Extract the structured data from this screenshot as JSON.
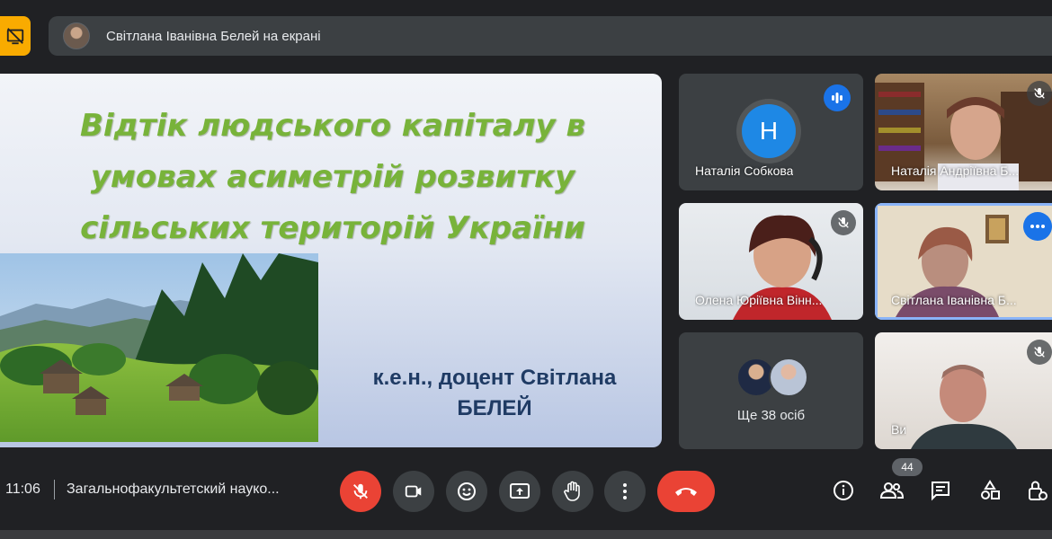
{
  "presenting_banner": {
    "text": "Світлана Іванівна Белей на екрані"
  },
  "slide": {
    "title": "Відтік  людського  капіталу в\nумовах асиметрій розвитку\nсільських територій України",
    "author_line1": "к.е.н., доцент Світлана",
    "author_line2": "БЕЛЕЙ",
    "title_color": "#78b33a",
    "author_color": "#1f3b64"
  },
  "participants": [
    {
      "name": "Наталія Собкова",
      "initial": "Н",
      "state": "speaking"
    },
    {
      "name": "Наталія Андріївна Б...",
      "state": "muted"
    },
    {
      "name": "Олена Юріївна Вінн...",
      "state": "muted"
    },
    {
      "name": "Світлана Іванівна Б...",
      "state": "presenting"
    },
    {
      "name": "Ви",
      "state": "muted"
    }
  ],
  "others": {
    "label": "Ще 38 осіб"
  },
  "bottom_bar": {
    "time": "11:06",
    "meeting_name": "Загальнофакультетский науко...",
    "participants_count": "44"
  },
  "icons": {
    "present": "present-off-icon",
    "mic": "mic-off-icon",
    "camera": "camera-icon",
    "emoji": "emoji-icon",
    "share": "present-screen-icon",
    "hand": "raise-hand-icon",
    "more": "more-vert-icon",
    "hangup": "call-end-icon",
    "info": "info-icon",
    "people": "people-icon",
    "chat": "chat-icon",
    "activities": "activities-icon",
    "lock": "host-controls-icon"
  },
  "colors": {
    "background": "#202124",
    "tile": "#3c4043",
    "accent_blue": "#1a73e8",
    "danger_red": "#ea4335",
    "present_yellow": "#f9ab00"
  }
}
